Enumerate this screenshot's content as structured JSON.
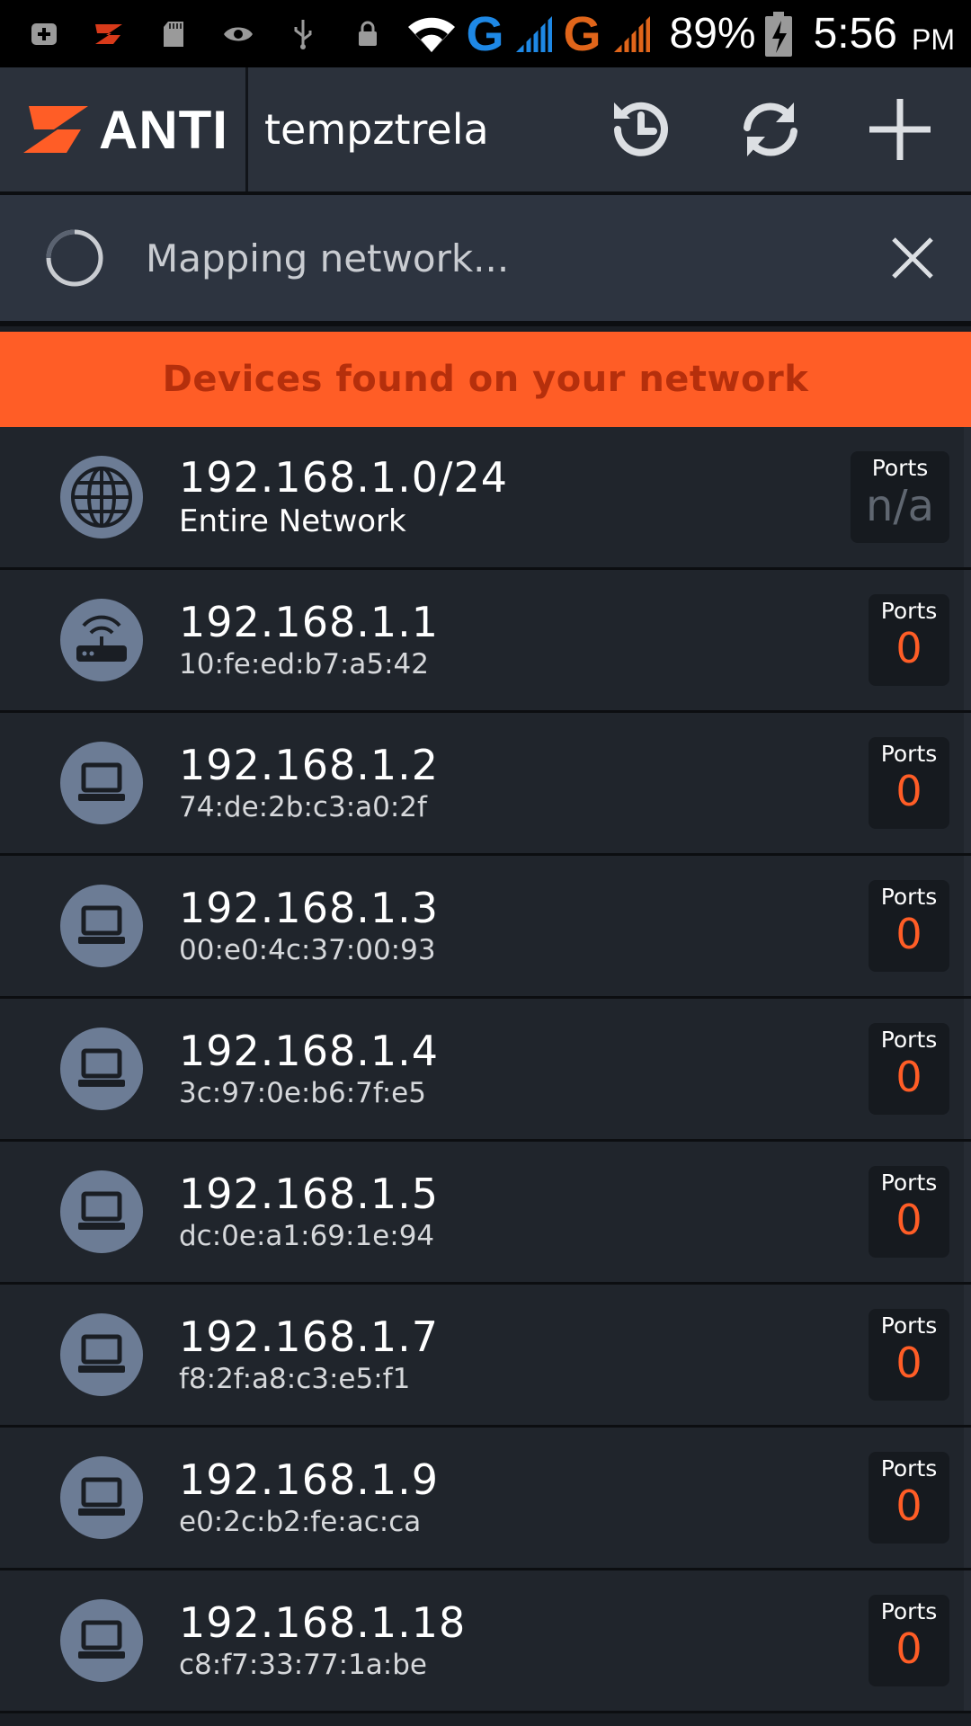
{
  "status_bar": {
    "network_label_1": "G",
    "network_label_2": "G",
    "battery": "89%",
    "time": "5:56",
    "ampm": "PM",
    "colors": {
      "g1": "#1e88e5",
      "g2": "#e0651a"
    }
  },
  "app_bar": {
    "brand": "ANTI",
    "title": "tempztrela",
    "actions": [
      "history-icon",
      "refresh-icon",
      "add-icon"
    ]
  },
  "scan": {
    "text": "Mapping network...",
    "close_icon": "close-icon"
  },
  "section": {
    "title": "Devices found on your network"
  },
  "devices": [
    {
      "ip": "192.168.1.0/24",
      "sub": "Entire Network",
      "ports_label": "Ports",
      "ports": "n/a",
      "icon": "globe-icon"
    },
    {
      "ip": "192.168.1.1",
      "sub": "10:fe:ed:b7:a5:42",
      "ports_label": "Ports",
      "ports": "0",
      "icon": "router-icon"
    },
    {
      "ip": "192.168.1.2",
      "sub": "74:de:2b:c3:a0:2f",
      "ports_label": "Ports",
      "ports": "0",
      "icon": "laptop-icon"
    },
    {
      "ip": "192.168.1.3",
      "sub": "00:e0:4c:37:00:93",
      "ports_label": "Ports",
      "ports": "0",
      "icon": "laptop-icon"
    },
    {
      "ip": "192.168.1.4",
      "sub": "3c:97:0e:b6:7f:e5",
      "ports_label": "Ports",
      "ports": "0",
      "icon": "laptop-icon"
    },
    {
      "ip": "192.168.1.5",
      "sub": "dc:0e:a1:69:1e:94",
      "ports_label": "Ports",
      "ports": "0",
      "icon": "laptop-icon"
    },
    {
      "ip": "192.168.1.7",
      "sub": "f8:2f:a8:c3:e5:f1",
      "ports_label": "Ports",
      "ports": "0",
      "icon": "laptop-icon"
    },
    {
      "ip": "192.168.1.9",
      "sub": "e0:2c:b2:fe:ac:ca",
      "ports_label": "Ports",
      "ports": "0",
      "icon": "laptop-icon"
    },
    {
      "ip": "192.168.1.18",
      "sub": "c8:f7:33:77:1a:be",
      "ports_label": "Ports",
      "ports": "0",
      "icon": "laptop-icon"
    }
  ],
  "colors": {
    "accent": "#ff5d26",
    "header_text": "#b52f0c",
    "icon_bg": "#6c7c95"
  }
}
